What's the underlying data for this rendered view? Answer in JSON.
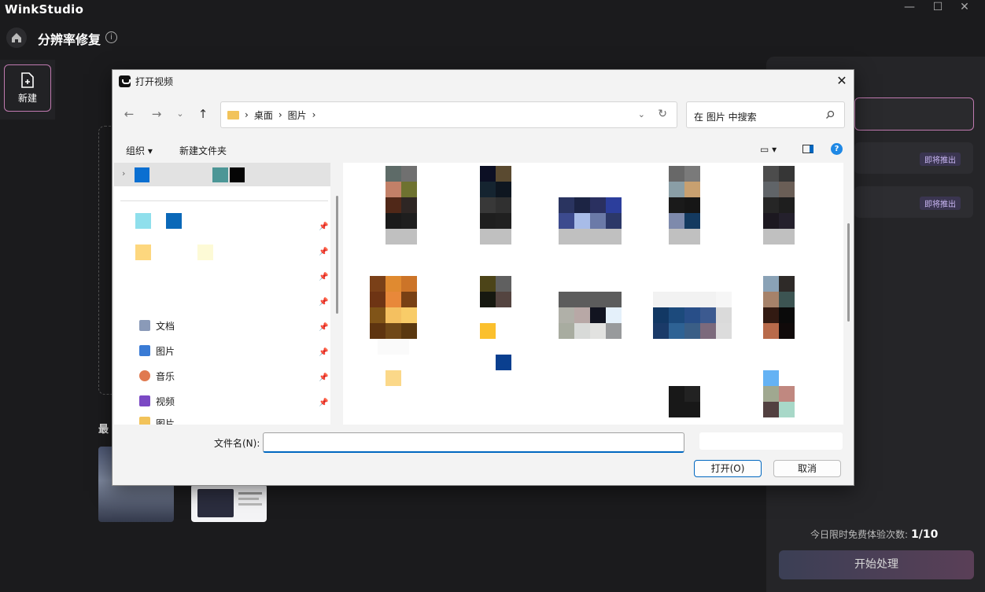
{
  "app": {
    "name": "WinkStudio",
    "page_title": "分辨率修复",
    "new_label": "新建",
    "recent_label": "最"
  },
  "right_panel": {
    "coming_soon_1": "即将推出",
    "coming_soon_2": "即将推出",
    "quota_label": "今日限时免费体验次数:",
    "quota_value": "1/10",
    "start_button": "开始处理"
  },
  "dialog": {
    "title": "打开视频",
    "breadcrumb": [
      "桌面",
      "图片"
    ],
    "breadcrumb_sep": "›",
    "search_placeholder": "在 图片 中搜索",
    "organize_label": "组织 ▾",
    "new_folder_label": "新建文件夹",
    "nav_items": [
      {
        "label": "文档",
        "icon": "documents-icon"
      },
      {
        "label": "图片",
        "icon": "pictures-icon"
      },
      {
        "label": "音乐",
        "icon": "music-icon"
      },
      {
        "label": "视频",
        "icon": "videos-icon"
      },
      {
        "label": "图片",
        "icon": "folder-icon"
      }
    ],
    "filename_label": "文件名(N):",
    "filename_value": "",
    "open_button": "打开(O)",
    "cancel_button": "取消"
  },
  "colors": {
    "accent_pink": "#c07ab0",
    "dialog_blue": "#0067c0",
    "badge_text": "#c9b6f3"
  }
}
